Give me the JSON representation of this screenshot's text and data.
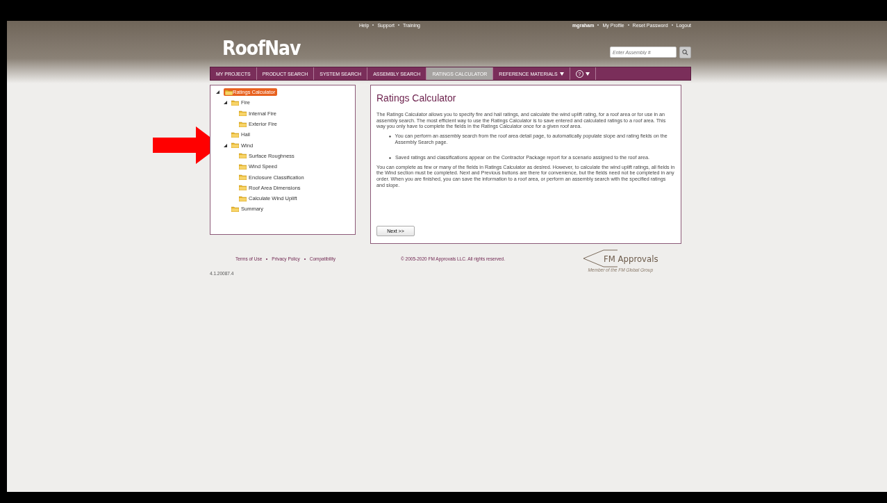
{
  "top_links": [
    "Help",
    "Support",
    "Training"
  ],
  "user_links": [
    {
      "label": "mgraham",
      "kind": "user"
    },
    {
      "label": "My Profile",
      "kind": "link"
    },
    {
      "label": "Reset Password",
      "kind": "link"
    },
    {
      "label": "Logout",
      "kind": "link"
    }
  ],
  "logo": "RoofNav",
  "search": {
    "placeholder": "Enter Assembly #"
  },
  "nav": [
    {
      "label": "MY PROJECTS",
      "selected": false,
      "kind": "tab"
    },
    {
      "label": "PRODUCT SEARCH",
      "selected": false,
      "kind": "tab"
    },
    {
      "label": "SYSTEM SEARCH",
      "selected": false,
      "kind": "tab"
    },
    {
      "label": "ASSEMBLY SEARCH",
      "selected": false,
      "kind": "tab"
    },
    {
      "label": "RATINGS CALCULATOR",
      "selected": true,
      "kind": "tab"
    },
    {
      "label": "REFERENCE MATERIALS",
      "selected": false,
      "kind": "menu"
    },
    {
      "label": "?",
      "selected": false,
      "kind": "help"
    }
  ],
  "tree": [
    {
      "label": "Ratings Calculator",
      "selected": true,
      "expanded": true,
      "children": [
        {
          "label": "Fire",
          "selected": false,
          "expanded": true,
          "children": [
            {
              "label": "Internal Fire",
              "selected": false
            },
            {
              "label": "Exterior Fire",
              "selected": false
            }
          ]
        },
        {
          "label": "Hail",
          "selected": false
        },
        {
          "label": "Wind",
          "selected": false,
          "expanded": true,
          "children": [
            {
              "label": "Surface Roughness",
              "selected": false
            },
            {
              "label": "Wind Speed",
              "selected": false
            },
            {
              "label": "Enclosure Classification",
              "selected": false
            },
            {
              "label": "Roof Area Dimensions",
              "selected": false
            },
            {
              "label": "Calculate Wind Uplift",
              "selected": false
            }
          ]
        },
        {
          "label": "Summary",
          "selected": false
        }
      ]
    }
  ],
  "content": {
    "title": "Ratings Calculator",
    "intro": "The Ratings Calculator allows you to specify fire and hail ratings, and calculate the wind uplift rating, for a roof area or for use in an assembly search. The most efficient way to use the Ratings Calculator is to save entered and calculated ratings to a roof area. This way you only have to complete the fields in the Ratings Calculator once for a given roof area.",
    "bullets": [
      "You can perform an assembly search from the roof area detail page, to automatically populate slope and rating fields on the Assembly Search page.",
      "Saved ratings and classifications appear on the Contractor Package report for a scenario assigned to the roof area."
    ],
    "outro": "You can complete as few or many of the fields in Ratings Calculator as desired. However, to calculate the wind uplift ratings, all fields in the Wind section must be completed. Next and Previous buttons are there for convenience, but the fields need not be completed in any order. When you are finished, you can save the information to a roof area, or perform an assembly search with the specified ratings and slope.",
    "button": "Next >>"
  },
  "footer_links": [
    "Terms of Use",
    "Privacy Policy",
    "Compatibility"
  ],
  "copyright": "© 2005-2020 FM Approvals LLC. All rights reserved.",
  "brand": {
    "name": "FM Approvals",
    "tagline": "Member of the FM Global Group"
  },
  "version": "4.1.20087.4"
}
